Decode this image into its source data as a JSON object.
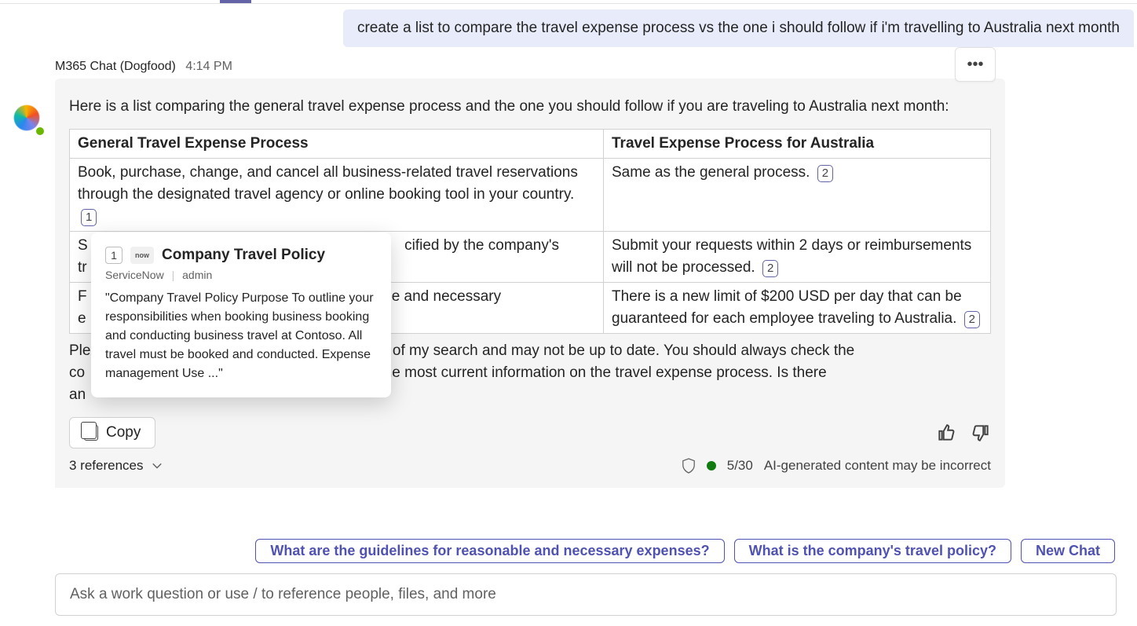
{
  "user_message": "create a list to compare the travel expense process vs the one i should follow if i'm travelling to Australia next month",
  "bot": {
    "name": "M365 Chat (Dogfood)",
    "time": "4:14 PM"
  },
  "response": {
    "intro": "Here is a list comparing the general travel expense process and the one you should follow if you are traveling to Australia next month:",
    "table": {
      "headers": [
        "General Travel Expense Process",
        "Travel Expense Process for Australia"
      ],
      "rows": [
        {
          "left": "Book, purchase, change, and cancel all business-related travel reservations through the designated travel agency or online booking tool in your country.",
          "left_ref": "1",
          "right": "Same as the general process.",
          "right_ref": "2"
        },
        {
          "left_cut_prefix": "S",
          "left_cut_suffix": "cified by the company's",
          "left_line2_prefix": "tr",
          "right": "Submit your requests within 2 days or reimbursements will not be processed.",
          "right_ref": "2"
        },
        {
          "left_cut_prefix": "F",
          "left_cut_suffix": "able and necessary",
          "left_line2_prefix": "e",
          "right": "There is a new limit of $200 USD per day that can be guaranteed for each employee traveling to Australia.",
          "right_ref": "2"
        }
      ]
    },
    "note_prefix": "Ple",
    "note_mid1": "n the results of my search and may not be up to date. You should always check the",
    "note_line2_prefix": "co",
    "note_mid2": "tment for the most current information on the travel expense process. Is there",
    "note_line3_prefix": "an"
  },
  "actions": {
    "copy": "Copy",
    "references_label": "3 references",
    "ai_safety_count": "5/30",
    "ai_disclaimer": "AI-generated content may be incorrect"
  },
  "suggestions": [
    "What are the guidelines for reasonable and necessary expenses?",
    "What is the company's travel policy?",
    "New Chat"
  ],
  "input_placeholder": "Ask a work question or use / to reference people, files, and more",
  "citation_popover": {
    "index": "1",
    "source_badge": "now",
    "title": "Company Travel Policy",
    "source": "ServiceNow",
    "author": "admin",
    "snippet": "\"Company Travel Policy Purpose To outline your responsibilities when booking business booking and conducting business travel at Contoso. All travel must be booked and conducted. Expense management Use ...\""
  }
}
